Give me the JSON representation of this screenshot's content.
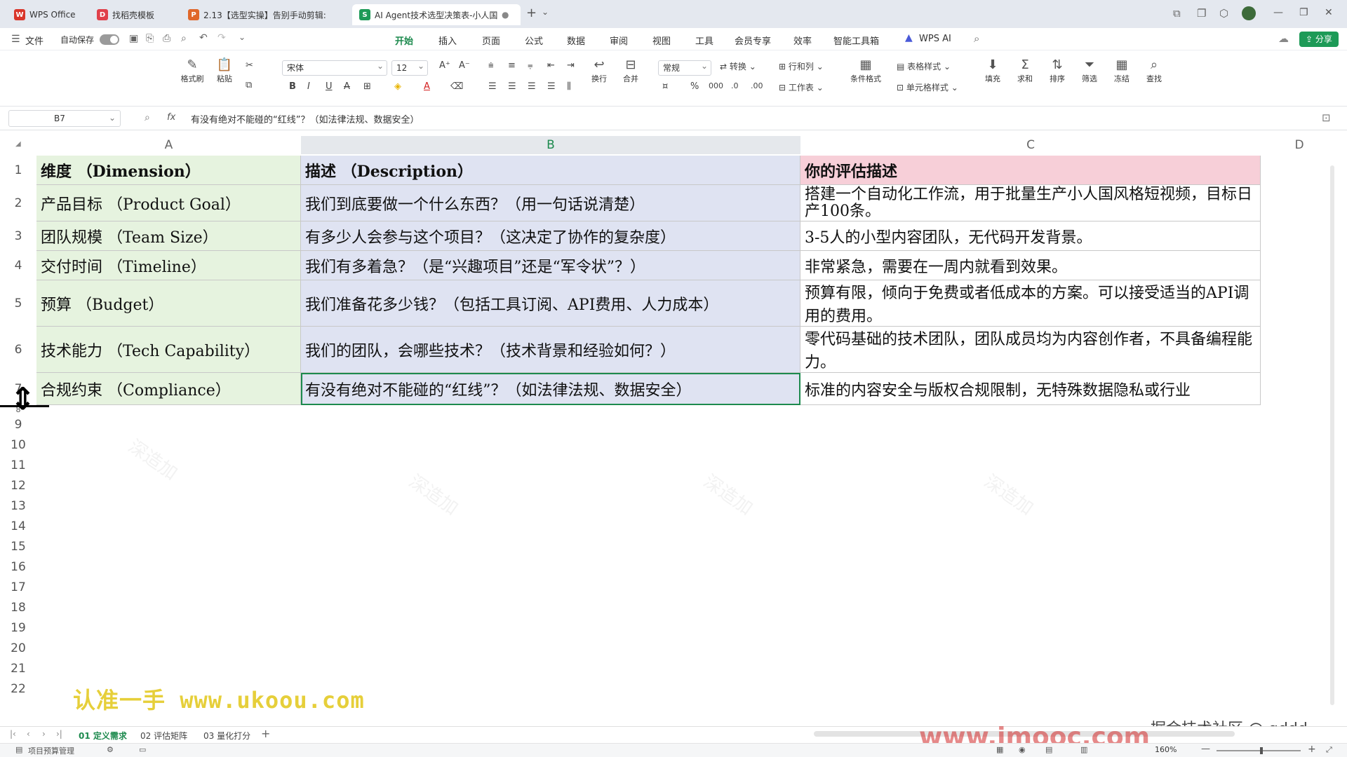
{
  "window": {
    "tabs": [
      {
        "label": "WPS Office",
        "icon": "W",
        "color": "#d9362b"
      },
      {
        "label": "找稻壳模板",
        "icon": "D",
        "color": "#e0404a"
      },
      {
        "label": "2.13【选型实操】告别手动剪辑:",
        "icon": "P",
        "color": "#e0672a"
      },
      {
        "label": "AI Agent技术选型决策表-小人国",
        "icon": "S",
        "color": "#1d9a57"
      }
    ]
  },
  "menubar": {
    "file": "文件",
    "autosave": "自动保存",
    "items": [
      "开始",
      "插入",
      "页面",
      "公式",
      "数据",
      "审阅",
      "视图",
      "工具",
      "会员专享",
      "效率",
      "智能工具箱"
    ],
    "wps_ai": "WPS AI",
    "share": "分享"
  },
  "ribbon": {
    "format_painter": "格式刷",
    "paste": "粘贴",
    "font_name": "宋体",
    "font_size": "12",
    "wrap": "换行",
    "merge": "合并",
    "number_format": "常规",
    "convert": "转换",
    "row_col": "行和列",
    "worksheet": "工作表",
    "cond_format": "条件格式",
    "table_style": "表格样式",
    "cell_style": "单元格样式",
    "fill": "填充",
    "sum": "求和",
    "sort": "排序",
    "filter": "筛选",
    "freeze": "冻结",
    "find": "查找"
  },
  "formula_bar": {
    "cell_ref": "B7",
    "fx": "fx",
    "content": "有没有绝对不能碰的“红线”？（如法律法规、数据安全）"
  },
  "grid": {
    "columns": [
      "A",
      "B",
      "C",
      "D"
    ],
    "selected_column": "B",
    "rows": [
      [
        "维度 （Dimension）",
        "描述 （Description）",
        "你的评估描述"
      ],
      [
        "产品目标 （Product  Goal）",
        "我们到底要做一个什么东西？（用一句话说清楚）",
        "搭建一个自动化工作流，用于批量生产小人国风格短视频，目标日产100条。"
      ],
      [
        "团队规模 （Team  Size）",
        "有多少人会参与这个项目？（这决定了协作的复杂度）",
        "3-5人的小型内容团队，无代码开发背景。"
      ],
      [
        "交付时间 （Timeline）",
        "我们有多着急？（是“兴趣项目”还是“军令状”？）",
        "非常紧急，需要在一周内就看到效果。"
      ],
      [
        "预算 （Budget）",
        "我们准备花多少钱？（包括工具订阅、API费用、人力成本）",
        "预算有限，倾向于免费或者低成本的方案。可以接受适当的API调用的费用。"
      ],
      [
        "技术能力 （Tech  Capability）",
        "我们的团队，会哪些技术？（技术背景和经验如何？）",
        "零代码基础的技术团队，团队成员均为内容创作者，不具备编程能力。"
      ],
      [
        "合规约束 （Compliance）",
        "有没有绝对不能碰的“红线”？（如法律法规、数据安全）",
        "标准的内容安全与版权合规限制，无特殊数据隐私或行业"
      ]
    ],
    "row_numbers": [
      "1",
      "2",
      "3",
      "4",
      "5",
      "6",
      "7",
      "8",
      "9",
      "10",
      "11",
      "12",
      "13",
      "14",
      "15",
      "16",
      "17",
      "18",
      "19",
      "20",
      "21",
      "22"
    ]
  },
  "overlay": {
    "watermark_left": "认准一手 www.ukoou.com",
    "watermark_right": "掘金技术社区 @ qddd",
    "watermark_bottom": "www.imooc.com",
    "watermark_tile": "深造加"
  },
  "sheets": [
    "01 定义需求",
    "02 评估矩阵",
    "03 量化打分"
  ],
  "statusbar": {
    "left": "项目预算管理",
    "zoom": "160%"
  }
}
